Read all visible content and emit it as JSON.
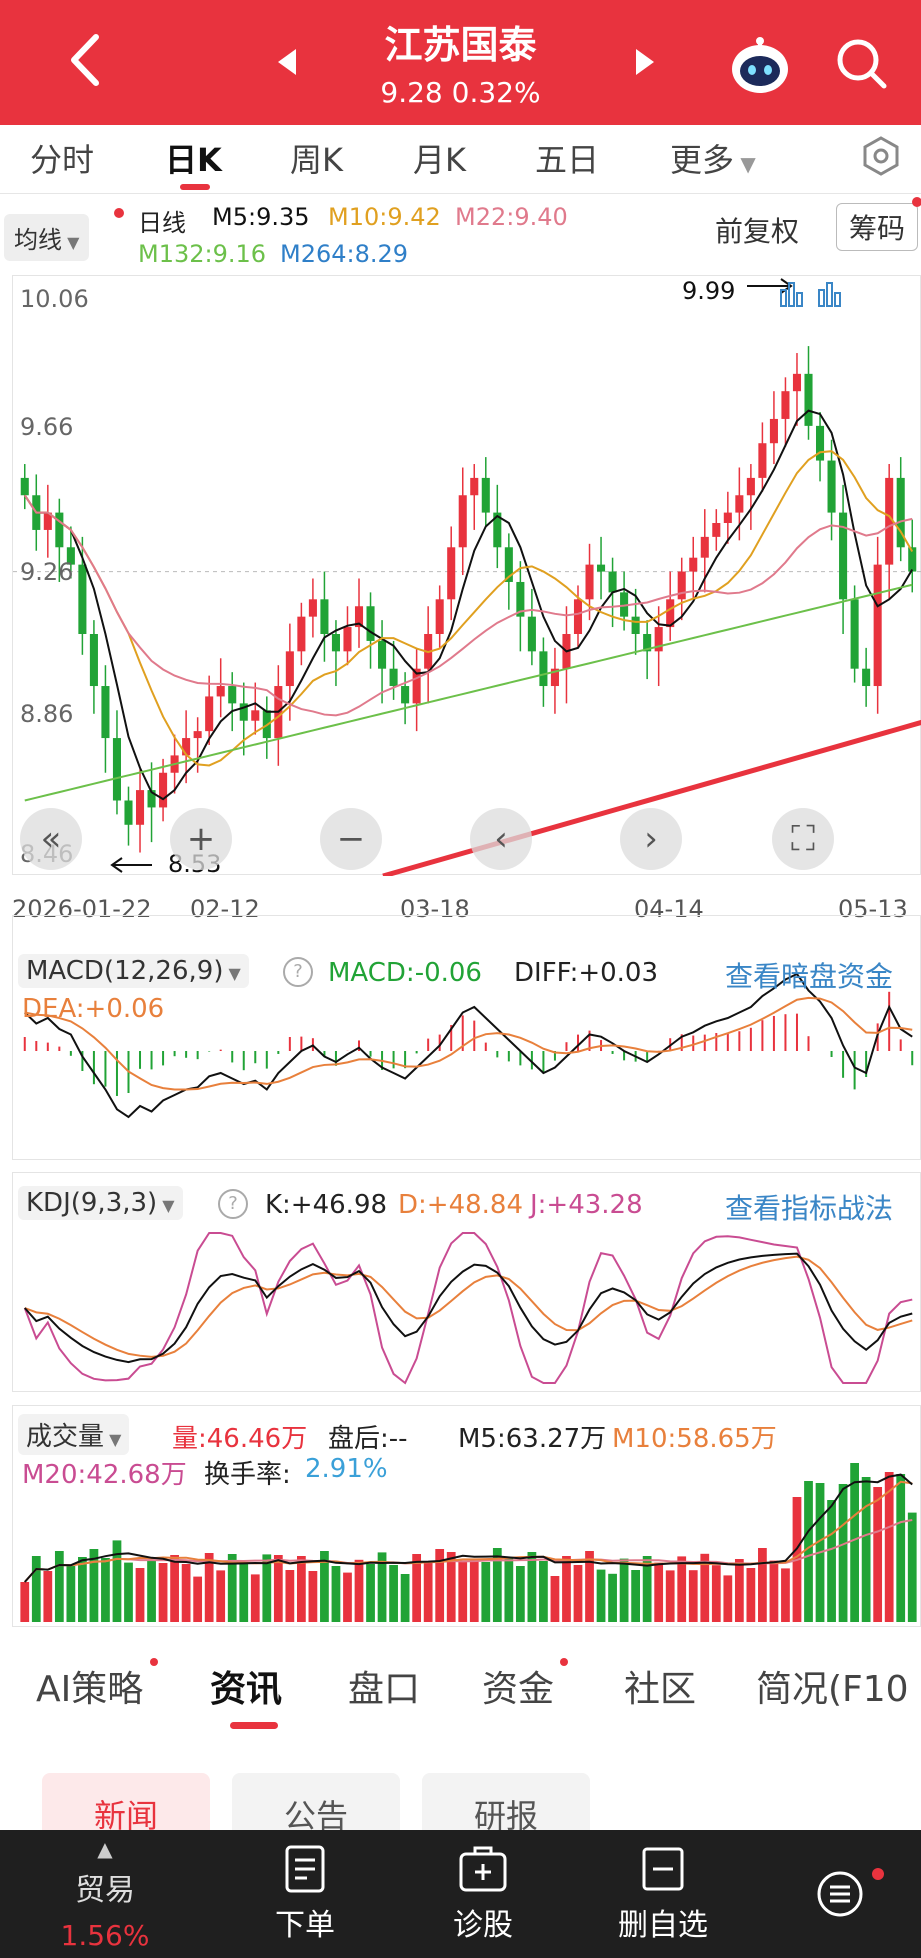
{
  "header": {
    "title": "江苏国泰",
    "price_change": "9.28 0.32%",
    "icons": [
      "back-arrow-icon",
      "prev-stock-icon",
      "next-stock-icon",
      "robot-assistant-icon",
      "search-icon"
    ]
  },
  "period_tabs": [
    "分时",
    "日K",
    "周K",
    "月K",
    "五日",
    "更多"
  ],
  "active_period": "日K",
  "ma_legend": {
    "selector": "均线",
    "line": "日线",
    "m5": "M5:9.35",
    "m10": "M10:9.42",
    "m22": "M22:9.40",
    "m132": "M132:9.16",
    "m264": "M264:8.29",
    "fuquan": "前复权",
    "chouma": "筹码"
  },
  "colors": {
    "up": "#e8333e",
    "down": "#21a336",
    "m5": "#111111",
    "m10": "#e0a020",
    "m22": "#e07a8c",
    "m132": "#6cc04a",
    "m264": "#2f7fc8",
    "link": "#3a86c6",
    "macd": "#21a336",
    "dea": "#e8803c",
    "kdj_j": "#c94c92"
  },
  "price_axis": {
    "labels": [
      "10.06",
      "9.66",
      "9.26",
      "8.86",
      "8.46"
    ],
    "min": 8.46,
    "max": 10.06
  },
  "annotations": {
    "high": "9.99",
    "low": "8.53"
  },
  "date_axis": [
    "2026-01-22",
    "02-12",
    "03-18",
    "04-14",
    "05-13"
  ],
  "nav_buttons": [
    "«",
    "+",
    "−",
    "‹",
    "›",
    "⛶"
  ],
  "macd": {
    "title": "MACD(12,26,9)",
    "macd": "MACD:-0.06",
    "diff": "DIFF:+0.03",
    "dea": "DEA:+0.06",
    "link": "查看暗盘资金"
  },
  "kdj": {
    "title": "KDJ(9,3,3)",
    "k": "K:+46.98",
    "d": "D:+48.84",
    "j": "J:+43.28",
    "link": "查看指标战法"
  },
  "volume": {
    "title": "成交量",
    "liang": "量:46.46万",
    "panhou": "盘后:-- ",
    "m5": "M5:63.27万",
    "m10": "M10:58.65万",
    "m20": "M20:42.68万",
    "turnover_label": "换手率:",
    "turnover": "2.91%"
  },
  "bottom_tabs": [
    "AI策略",
    "资讯",
    "盘口",
    "资金",
    "社区",
    "简况(F10"
  ],
  "active_bottom_tab": "资讯",
  "sub_chips": [
    "新闻",
    "公告",
    "研报"
  ],
  "bottom_nav": {
    "trade": "贸易",
    "trade_pct": "1.56%",
    "order": "下单",
    "diagnose": "诊股",
    "remove": "删自选"
  },
  "chart_data": {
    "type": "candlestick",
    "title": "",
    "ylim": [
      8.46,
      10.06
    ],
    "close": [
      9.5,
      9.4,
      9.45,
      9.35,
      9.3,
      9.1,
      8.95,
      8.8,
      8.62,
      8.55,
      8.65,
      8.6,
      8.7,
      8.75,
      8.8,
      8.82,
      8.92,
      8.95,
      8.9,
      8.85,
      8.88,
      8.8,
      8.95,
      9.05,
      9.15,
      9.2,
      9.1,
      9.05,
      9.12,
      9.18,
      9.08,
      9.0,
      8.95,
      8.9,
      9.0,
      9.1,
      9.2,
      9.35,
      9.5,
      9.55,
      9.45,
      9.35,
      9.25,
      9.15,
      9.05,
      8.95,
      9.0,
      9.1,
      9.2,
      9.3,
      9.28,
      9.22,
      9.15,
      9.1,
      9.05,
      9.12,
      9.2,
      9.28,
      9.32,
      9.38,
      9.42,
      9.45,
      9.5,
      9.55,
      9.65,
      9.72,
      9.8,
      9.85,
      9.7,
      9.6,
      9.45,
      9.2,
      9.0,
      8.95,
      9.3,
      9.55,
      9.35,
      9.28
    ]
  }
}
